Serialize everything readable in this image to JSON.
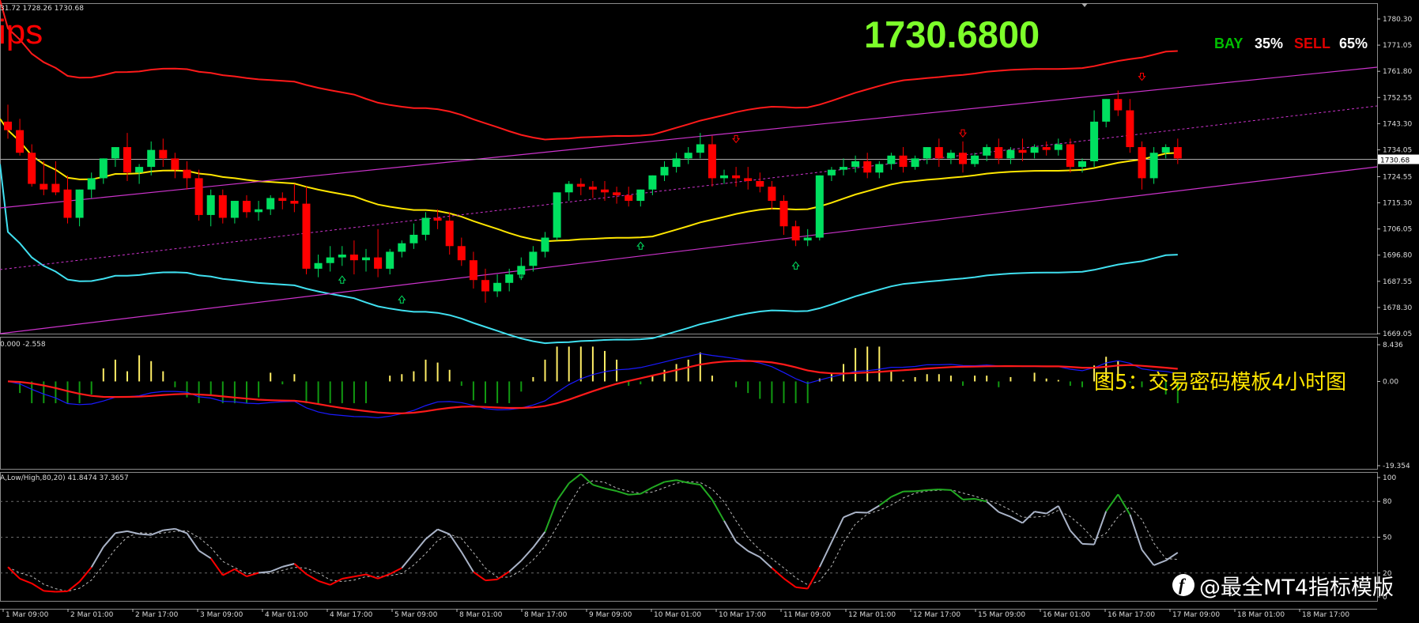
{
  "main_window": {
    "ohlc_header": "31.72 1728.26 1730.68",
    "big_price": "1730.6800",
    "ips_label": "ips",
    "bay_label": "BAY",
    "bay_percent": "35%",
    "sell_label": "SELL",
    "sell_percent": "65%",
    "current_price_tag": "1730.68"
  },
  "macd_window": {
    "header": "0.000 -2.558",
    "caption": "图5：交易密码模板4小时图"
  },
  "stoch_window": {
    "header": "A,Low/High,80,20) 41.8474 37.3657"
  },
  "watermark": {
    "icon": "toutiao-logo-icon",
    "text": "@最全MT4指标模版"
  },
  "colors": {
    "background": "#000000",
    "bull": "#00e060",
    "bear": "#ff0000",
    "upper_band": "#ff1a1a",
    "lower_band": "#40e0f0",
    "mid_ma": "#ffe600",
    "channel": "#cc33cc",
    "macd_fast": "#1a1aff",
    "macd_slow": "#ff1a1a",
    "hist_pos": "#ffee66",
    "hist_neg": "#119911",
    "stoch_main": "#aab4c8",
    "stoch_overbought": "#22aa22",
    "stoch_oversold": "#ff0000",
    "grid": "#6a6a6a"
  },
  "chart_data": [
    {
      "type": "candlestick",
      "y_ticks": [
        "1780.30",
        "1771.05",
        "1761.80",
        "1752.55",
        "1743.30",
        "1734.05",
        "1724.55",
        "1715.30",
        "1706.05",
        "1696.80",
        "1687.55",
        "1678.30",
        "1669.05"
      ],
      "ylim": [
        1669.05,
        1780.3
      ],
      "current_price": 1730.68,
      "x_labels": [
        "1 Mar 09:00",
        "2 Mar 01:00",
        "2 Mar 17:00",
        "3 Mar 09:00",
        "4 Mar 01:00",
        "4 Mar 17:00",
        "5 Mar 09:00",
        "8 Mar 01:00",
        "8 Mar 17:00",
        "9 Mar 09:00",
        "10 Mar 01:00",
        "10 Mar 17:00",
        "11 Mar 09:00",
        "12 Mar 01:00",
        "12 Mar 17:00",
        "15 Mar 09:00",
        "16 Mar 01:00",
        "16 Mar 17:00",
        "17 Mar 09:00",
        "18 Mar 01:00",
        "18 Mar 17:00"
      ],
      "candles": [
        [
          1744,
          1750,
          1741,
          1738
        ],
        [
          1741,
          1745,
          1733,
          1732
        ],
        [
          1733,
          1736,
          1722,
          1721
        ],
        [
          1722,
          1730,
          1720,
          1718
        ],
        [
          1722,
          1730,
          1719,
          1718
        ],
        [
          1720,
          1725,
          1710,
          1708
        ],
        [
          1710,
          1718,
          1720,
          1707
        ],
        [
          1720,
          1726,
          1724,
          1717
        ],
        [
          1724,
          1730,
          1731,
          1722
        ],
        [
          1731,
          1735,
          1735,
          1728
        ],
        [
          1735,
          1740,
          1726,
          1723
        ],
        [
          1726,
          1729,
          1728,
          1722
        ],
        [
          1728,
          1737,
          1734,
          1725
        ],
        [
          1734,
          1738,
          1731,
          1728
        ],
        [
          1731,
          1733,
          1727,
          1724
        ],
        [
          1727,
          1730,
          1724,
          1720
        ],
        [
          1724,
          1727,
          1711,
          1709
        ],
        [
          1711,
          1720,
          1718,
          1707
        ],
        [
          1718,
          1720,
          1710,
          1708
        ],
        [
          1710,
          1716,
          1716,
          1708
        ],
        [
          1716,
          1718,
          1712,
          1710
        ],
        [
          1712,
          1716,
          1713,
          1709
        ],
        [
          1713,
          1718,
          1717,
          1711
        ],
        [
          1717,
          1719,
          1716,
          1713
        ],
        [
          1716,
          1722,
          1715,
          1712
        ],
        [
          1715,
          1721,
          1692,
          1690
        ],
        [
          1692,
          1697,
          1694,
          1689
        ],
        [
          1694,
          1700,
          1696,
          1691
        ],
        [
          1696,
          1700,
          1697,
          1693
        ],
        [
          1697,
          1702,
          1695,
          1690
        ],
        [
          1695,
          1699,
          1696,
          1691
        ],
        [
          1696,
          1706,
          1692,
          1689
        ],
        [
          1692,
          1699,
          1698,
          1690
        ],
        [
          1698,
          1702,
          1701,
          1696
        ],
        [
          1701,
          1708,
          1704,
          1699
        ],
        [
          1704,
          1712,
          1710,
          1702
        ],
        [
          1710,
          1713,
          1709,
          1706
        ],
        [
          1709,
          1712,
          1700,
          1697
        ],
        [
          1700,
          1703,
          1695,
          1693
        ],
        [
          1695,
          1698,
          1688,
          1685
        ],
        [
          1688,
          1692,
          1684,
          1680
        ],
        [
          1684,
          1690,
          1687,
          1682
        ],
        [
          1687,
          1692,
          1690,
          1684
        ],
        [
          1690,
          1696,
          1693,
          1688
        ],
        [
          1693,
          1700,
          1698,
          1691
        ],
        [
          1698,
          1705,
          1703,
          1696
        ],
        [
          1703,
          1708,
          1719,
          1702
        ],
        [
          1719,
          1723,
          1722,
          1716
        ],
        [
          1722,
          1724,
          1721,
          1718
        ],
        [
          1721,
          1723,
          1720,
          1717
        ],
        [
          1720,
          1723,
          1719,
          1716
        ],
        [
          1719,
          1721,
          1718,
          1715
        ],
        [
          1718,
          1721,
          1716,
          1714
        ],
        [
          1716,
          1720,
          1720,
          1714
        ],
        [
          1720,
          1723,
          1725,
          1718
        ],
        [
          1725,
          1730,
          1728,
          1723
        ],
        [
          1728,
          1733,
          1731,
          1726
        ],
        [
          1731,
          1735,
          1733,
          1729
        ],
        [
          1733,
          1740,
          1736,
          1731
        ],
        [
          1736,
          1739,
          1724,
          1721
        ],
        [
          1724,
          1727,
          1725,
          1722
        ],
        [
          1725,
          1728,
          1724,
          1721
        ],
        [
          1724,
          1728,
          1723,
          1720
        ],
        [
          1723,
          1726,
          1721,
          1719
        ],
        [
          1721,
          1723,
          1716,
          1713
        ],
        [
          1716,
          1718,
          1707,
          1704
        ],
        [
          1707,
          1709,
          1702,
          1700
        ],
        [
          1702,
          1706,
          1703,
          1700
        ],
        [
          1703,
          1707,
          1725,
          1702
        ],
        [
          1725,
          1728,
          1727,
          1723
        ],
        [
          1727,
          1731,
          1728,
          1725
        ],
        [
          1728,
          1732,
          1730,
          1726
        ],
        [
          1730,
          1733,
          1726,
          1724
        ],
        [
          1726,
          1730,
          1729,
          1724
        ],
        [
          1729,
          1733,
          1732,
          1727
        ],
        [
          1732,
          1735,
          1728,
          1726
        ],
        [
          1728,
          1732,
          1731,
          1727
        ],
        [
          1731,
          1735,
          1735,
          1729
        ],
        [
          1735,
          1738,
          1731,
          1728
        ],
        [
          1731,
          1734,
          1733,
          1729
        ],
        [
          1733,
          1737,
          1729,
          1726
        ],
        [
          1729,
          1733,
          1732,
          1728
        ],
        [
          1732,
          1736,
          1735,
          1730
        ],
        [
          1735,
          1738,
          1731,
          1729
        ],
        [
          1731,
          1735,
          1734,
          1729
        ],
        [
          1734,
          1738,
          1733,
          1730
        ],
        [
          1733,
          1736,
          1735,
          1731
        ],
        [
          1735,
          1737,
          1734,
          1732
        ],
        [
          1734,
          1738,
          1736,
          1732
        ],
        [
          1736,
          1738,
          1728,
          1726
        ],
        [
          1728,
          1731,
          1730,
          1726
        ],
        [
          1730,
          1748,
          1744,
          1728
        ],
        [
          1744,
          1752,
          1752,
          1742
        ],
        [
          1752,
          1755,
          1748,
          1746
        ],
        [
          1748,
          1752,
          1735,
          1733
        ],
        [
          1735,
          1737,
          1724,
          1720
        ],
        [
          1724,
          1735,
          1733,
          1722
        ],
        [
          1733,
          1736,
          1735,
          1731
        ],
        [
          1735,
          1738,
          1731,
          1729
        ]
      ]
    },
    {
      "type": "histogram+line",
      "y_ticks": [
        "8.436",
        "0.00",
        "-19.354"
      ],
      "ylim": [
        -19.354,
        8.436
      ]
    },
    {
      "type": "line",
      "y_ticks": [
        "100",
        "80",
        "50",
        "20",
        "0"
      ],
      "ylim": [
        0,
        100
      ]
    }
  ]
}
